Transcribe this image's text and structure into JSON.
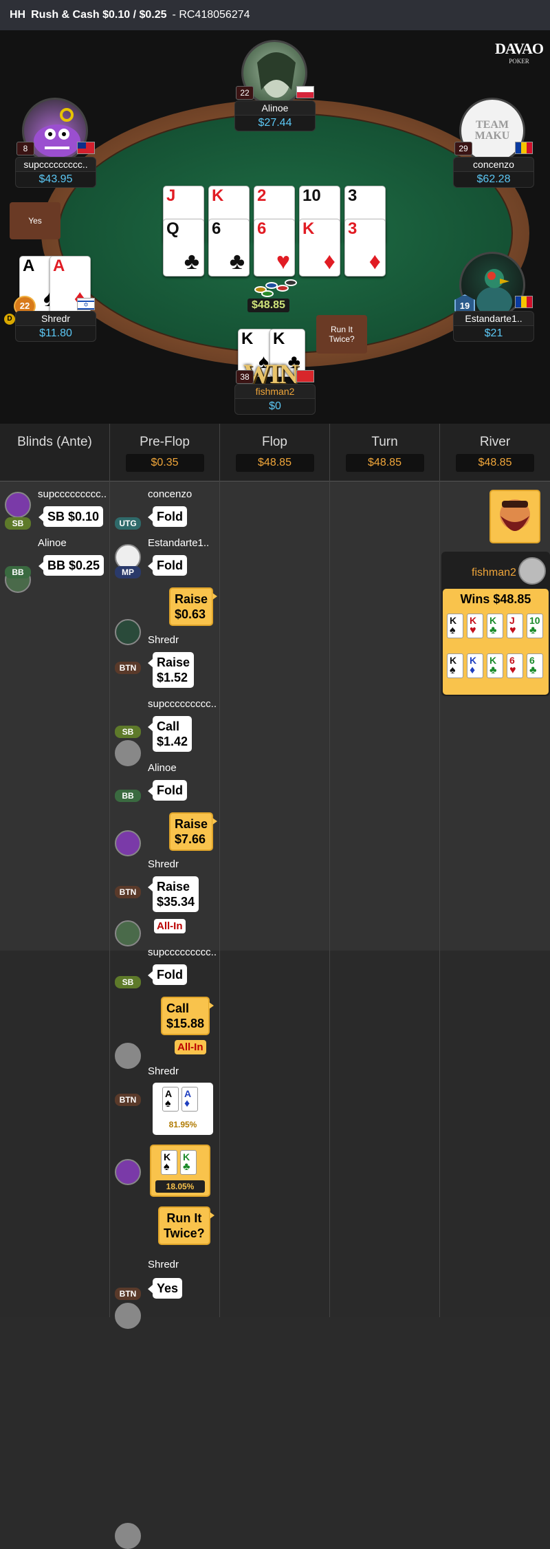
{
  "header": {
    "title_prefix": "HH",
    "title": "Rush & Cash $0.10 / $0.25",
    "hand_id": "- RC418056274"
  },
  "logo": {
    "line1": "DAVAO",
    "line2": "POKER"
  },
  "seats": {
    "alinoe": {
      "name": "Alinoe",
      "stack": "$27.44",
      "level": "22"
    },
    "supc": {
      "name": "supccccccccc..",
      "stack": "$43.95",
      "level": "8"
    },
    "concenzo": {
      "name": "concenzo",
      "stack": "$62.28",
      "level": "29",
      "avatar_text": "TEAM MAKU"
    },
    "shredr": {
      "name": "Shredr",
      "stack": "$11.80",
      "level": "22"
    },
    "estandarte": {
      "name": "Estandarte1..",
      "stack": "$21",
      "level": "19"
    },
    "fishman": {
      "name": "fishman2",
      "stack": "$0",
      "level": "38"
    }
  },
  "buttons": {
    "yes": "Yes",
    "run_it_twice": "Run It Twice?"
  },
  "board": {
    "top": [
      {
        "r": "J",
        "s": "♥",
        "c": "red"
      },
      {
        "r": "K",
        "s": "♥",
        "c": "red"
      },
      {
        "r": "2",
        "s": "♦",
        "c": "red"
      },
      {
        "r": "10",
        "s": "♣",
        "c": "blk"
      },
      {
        "r": "3",
        "s": "♠",
        "c": "blk"
      }
    ],
    "bottom": [
      {
        "r": "Q",
        "s": "♣",
        "c": "blk"
      },
      {
        "r": "6",
        "s": "♣",
        "c": "blk"
      },
      {
        "r": "6",
        "s": "♥",
        "c": "red"
      },
      {
        "r": "K",
        "s": "♦",
        "c": "red"
      },
      {
        "r": "3",
        "s": "♦",
        "c": "red"
      }
    ]
  },
  "pot": "$48.85",
  "dealer_label": "D",
  "win_label": "WIN",
  "shredr_cards": [
    {
      "r": "A",
      "s": "♠",
      "c": "blk"
    },
    {
      "r": "A",
      "s": "♦",
      "c": "red"
    }
  ],
  "fishman_cards": [
    {
      "r": "K",
      "s": "♠",
      "c": "blk"
    },
    {
      "r": "K",
      "s": "♣",
      "c": "blk"
    }
  ],
  "hh": {
    "columns": [
      {
        "label": "Blinds (Ante)",
        "pot": ""
      },
      {
        "label": "Pre-Flop",
        "pot": "$0.35"
      },
      {
        "label": "Flop",
        "pot": "$48.85"
      },
      {
        "label": "Turn",
        "pot": "$48.85"
      },
      {
        "label": "River",
        "pot": "$48.85"
      }
    ],
    "blinds": [
      {
        "name": "supccccccccc..",
        "pos": "SB",
        "action": "SB $0.10"
      },
      {
        "name": "Alinoe",
        "pos": "BB",
        "action": "BB $0.25"
      }
    ],
    "preflop": {
      "concenzo": {
        "name": "concenzo",
        "pos": "UTG",
        "action": "Fold"
      },
      "estandarte": {
        "name": "Estandarte1..",
        "pos": "MP",
        "action": "Fold"
      },
      "hero_raise1": {
        "l1": "Raise",
        "l2": "$0.63"
      },
      "shredr1": {
        "name": "Shredr",
        "pos": "BTN",
        "l1": "Raise",
        "l2": "$1.52"
      },
      "supc1": {
        "name": "supccccccccc..",
        "pos": "SB",
        "l1": "Call",
        "l2": "$1.42"
      },
      "alinoe": {
        "name": "Alinoe",
        "pos": "BB",
        "action": "Fold"
      },
      "hero_raise2": {
        "l1": "Raise",
        "l2": "$7.66"
      },
      "shredr2": {
        "name": "Shredr",
        "pos": "BTN",
        "l1": "Raise",
        "l2": "$35.34",
        "allin": "All-In"
      },
      "supc2": {
        "name": "supccccccccc..",
        "pos": "SB",
        "action": "Fold"
      },
      "hero_call": {
        "l1": "Call",
        "l2": "$15.88",
        "allin": "All-In"
      },
      "shredr3": {
        "name": "Shredr",
        "pos": "BTN",
        "equity": "81.95%"
      },
      "hero_equity": "18.05%",
      "hero_rit": {
        "l1": "Run It",
        "l2": "Twice?"
      },
      "shredr4": {
        "name": "Shredr",
        "pos": "BTN",
        "action": "Yes"
      }
    },
    "river": {
      "winner": "fishman2",
      "wins": "Wins $48.85",
      "run1": [
        {
          "r": "K",
          "s": "♠",
          "c": "blk"
        },
        {
          "r": "K",
          "s": "♥",
          "c": "red"
        },
        {
          "r": "K",
          "s": "♣",
          "c": "grn"
        },
        {
          "r": "J",
          "s": "♥",
          "c": "red"
        },
        {
          "r": "10",
          "s": "♣",
          "c": "grn"
        }
      ],
      "run2": [
        {
          "r": "K",
          "s": "♠",
          "c": "blk"
        },
        {
          "r": "K",
          "s": "♦",
          "c": "blu"
        },
        {
          "r": "K",
          "s": "♣",
          "c": "grn"
        },
        {
          "r": "6",
          "s": "♥",
          "c": "red"
        },
        {
          "r": "6",
          "s": "♣",
          "c": "grn"
        }
      ]
    }
  }
}
